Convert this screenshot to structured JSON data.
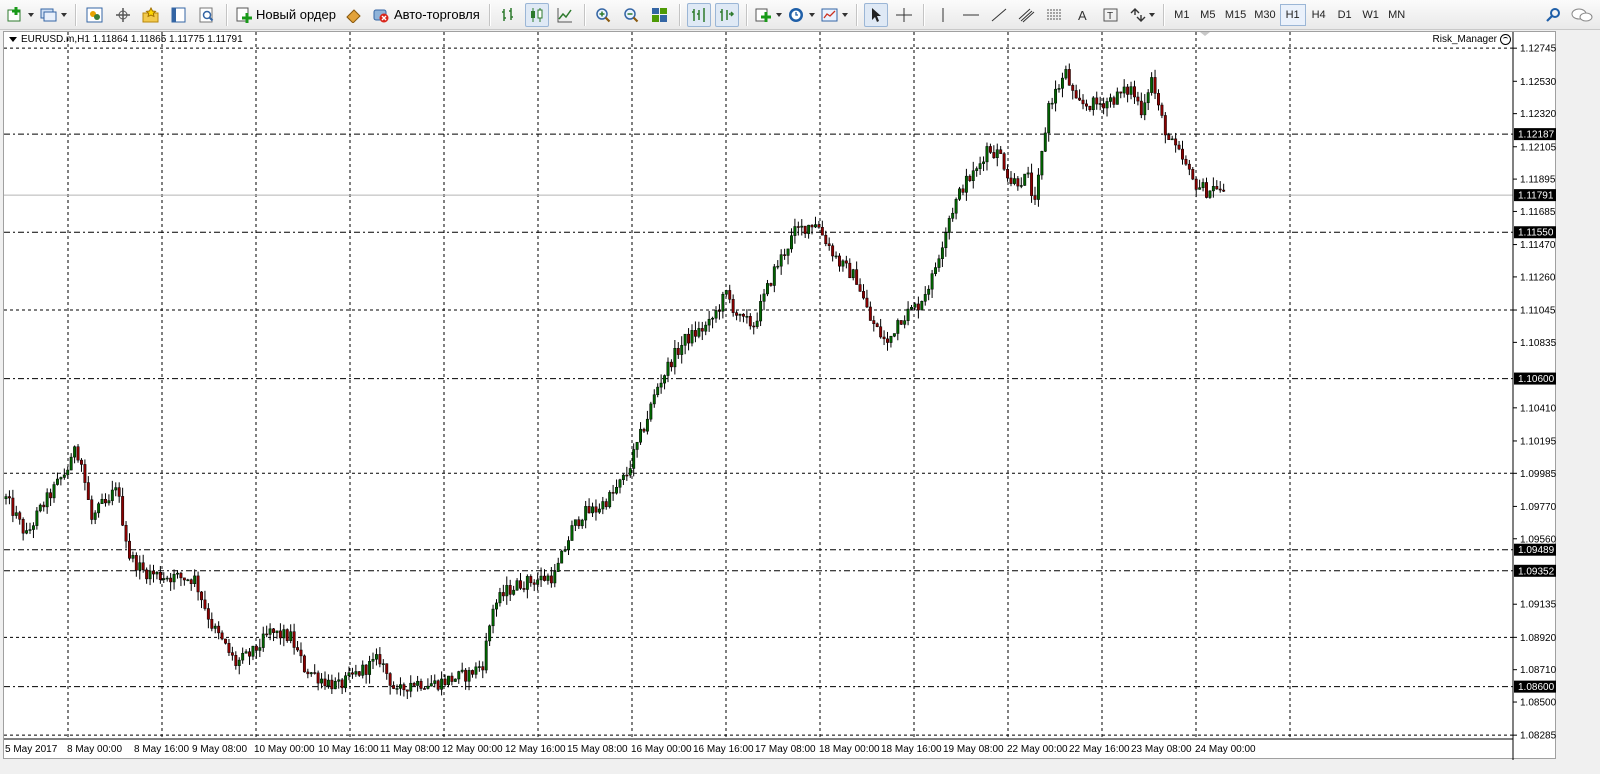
{
  "toolbar": {
    "new_order_label": "Новый ордер",
    "autotrading_label": "Авто-торговля",
    "timeframes": [
      "M1",
      "M5",
      "M15",
      "M30",
      "H1",
      "H4",
      "D1",
      "W1",
      "MN"
    ],
    "active_timeframe": "H1"
  },
  "chart": {
    "symbol_line": "EURUSD.m,H1  1.11864 1.11865 1.11775 1.11791",
    "ea_name": "Risk_Manager",
    "colors": {
      "bull": "#006400",
      "bear": "#8b0000",
      "grid": "#000000",
      "tag_bg": "#000000",
      "tag_text": "#ffffff"
    },
    "price_axis_labels": [
      "1.12745",
      "1.12530",
      "1.12320",
      "1.12105",
      "1.11895",
      "1.11685",
      "1.11470",
      "1.11260",
      "1.11045",
      "1.10835",
      "1.10410",
      "1.10195",
      "1.09985",
      "1.09770",
      "1.09560",
      "1.09135",
      "1.08920",
      "1.08710",
      "1.08500",
      "1.08285"
    ],
    "level_tags": [
      "1.12187",
      "1.11791",
      "1.11550",
      "1.10600",
      "1.09489",
      "1.09352",
      "1.08600"
    ],
    "time_axis_labels": [
      "5 May 2017",
      "8 May 00:00",
      "8 May 16:00",
      "9 May 08:00",
      "10 May 00:00",
      "10 May 16:00",
      "11 May 08:00",
      "12 May 00:00",
      "12 May 16:00",
      "15 May 08:00",
      "16 May 00:00",
      "16 May 16:00",
      "17 May 08:00",
      "18 May 00:00",
      "18 May 16:00",
      "19 May 08:00",
      "22 May 00:00",
      "22 May 16:00",
      "23 May 08:00",
      "24 May 00:00"
    ]
  },
  "chart_data": {
    "type": "candlestick",
    "symbol": "EURUSD.m",
    "timeframe": "H1",
    "ylim": [
      1.0826,
      1.1285
    ],
    "horizontal_levels": [
      1.12187,
      1.1155,
      1.106,
      1.09489,
      1.09352,
      1.086
    ],
    "bid_level": 1.11791,
    "close_path": [
      [
        0,
        1.0982
      ],
      [
        6,
        1.0958
      ],
      [
        10,
        1.0975
      ],
      [
        16,
        1.0995
      ],
      [
        19,
        1.1005
      ],
      [
        20,
        1.1018
      ],
      [
        22,
        1.1005
      ],
      [
        25,
        1.0968
      ],
      [
        28,
        1.0978
      ],
      [
        30,
        1.0978
      ],
      [
        32,
        1.0992
      ],
      [
        36,
        1.0945
      ],
      [
        40,
        1.0935
      ],
      [
        45,
        1.0932
      ],
      [
        55,
        1.093
      ],
      [
        60,
        1.09
      ],
      [
        67,
        1.0875
      ],
      [
        72,
        1.0882
      ],
      [
        77,
        1.0895
      ],
      [
        83,
        1.0892
      ],
      [
        87,
        1.0872
      ],
      [
        92,
        1.0865
      ],
      [
        97,
        1.086
      ],
      [
        102,
        1.0868
      ],
      [
        109,
        1.0878
      ],
      [
        114,
        1.0855
      ],
      [
        118,
        1.0863
      ],
      [
        125,
        1.0862
      ],
      [
        130,
        1.0865
      ],
      [
        135,
        1.0868
      ],
      [
        139,
        1.0875
      ],
      [
        142,
        1.0912
      ],
      [
        146,
        1.0922
      ],
      [
        150,
        1.0927
      ],
      [
        160,
        1.0932
      ],
      [
        165,
        1.0962
      ],
      [
        168,
        1.0972
      ],
      [
        172,
        1.0975
      ],
      [
        177,
        1.0985
      ],
      [
        181,
        1.0998
      ],
      [
        187,
        1.1035
      ],
      [
        190,
        1.1055
      ],
      [
        194,
        1.1072
      ],
      [
        198,
        1.1085
      ],
      [
        205,
        1.1095
      ],
      [
        210,
        1.1115
      ],
      [
        214,
        1.1098
      ],
      [
        218,
        1.1095
      ],
      [
        224,
        1.113
      ],
      [
        230,
        1.1155
      ],
      [
        236,
        1.1162
      ],
      [
        239,
        1.115
      ],
      [
        243,
        1.1135
      ],
      [
        248,
        1.1125
      ],
      [
        252,
        1.1098
      ],
      [
        257,
        1.1082
      ],
      [
        260,
        1.1098
      ],
      [
        266,
        1.1108
      ],
      [
        270,
        1.1125
      ],
      [
        275,
        1.1165
      ],
      [
        279,
        1.1185
      ],
      [
        283,
        1.1195
      ],
      [
        286,
        1.121
      ],
      [
        290,
        1.1205
      ],
      [
        293,
        1.1188
      ],
      [
        298,
        1.119
      ],
      [
        300,
        1.1172
      ],
      [
        302,
        1.1205
      ],
      [
        304,
        1.1238
      ],
      [
        309,
        1.1258
      ],
      [
        312,
        1.1238
      ],
      [
        318,
        1.1238
      ],
      [
        323,
        1.1242
      ],
      [
        328,
        1.1248
      ],
      [
        331,
        1.1235
      ],
      [
        334,
        1.1255
      ],
      [
        336,
        1.1235
      ],
      [
        339,
        1.1215
      ],
      [
        343,
        1.1202
      ],
      [
        346,
        1.1188
      ],
      [
        350,
        1.1182
      ],
      [
        353,
        1.1185
      ],
      [
        355,
        1.1179
      ]
    ]
  }
}
